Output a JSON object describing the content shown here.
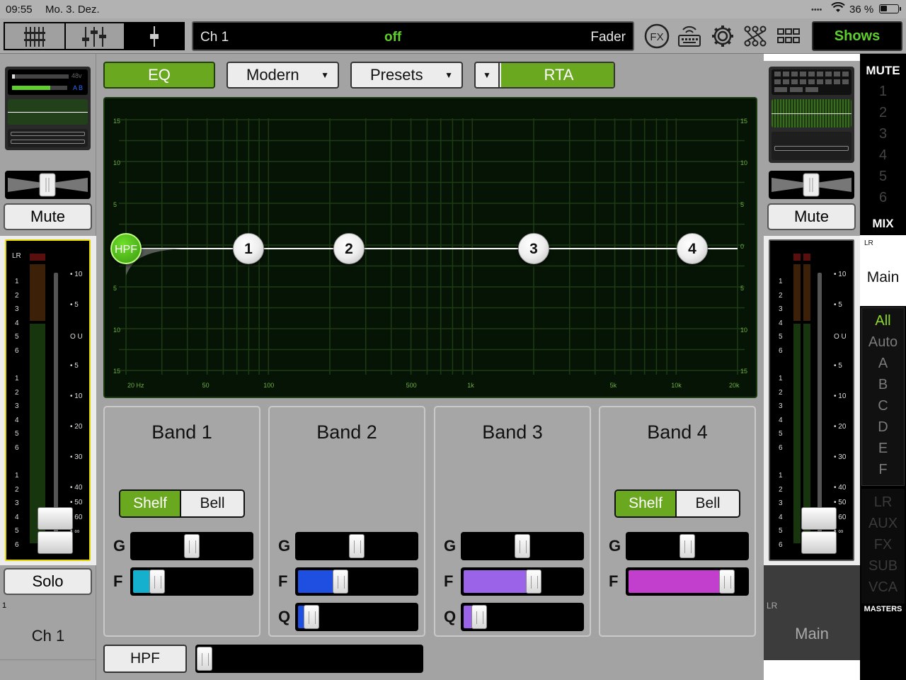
{
  "status": {
    "time": "09:55",
    "date": "Mo. 3. Dez.",
    "battery": "36 %"
  },
  "channel_bar": {
    "name": "Ch 1",
    "state": "off",
    "mode": "Fader"
  },
  "toolbar": {
    "fx_label": "FX",
    "shows_label": "Shows"
  },
  "left": {
    "mute_label": "Mute",
    "solo_label": "Solo",
    "channel_num": "1",
    "channel_name": "Ch 1",
    "phantom": "48v",
    "ab": "A B",
    "meter_lr": "LR"
  },
  "right": {
    "mute_label": "Mute",
    "lr_label": "LR",
    "main_label": "Main",
    "main_bottom": "Main",
    "lr_bottom": "LR"
  },
  "masters": {
    "mute_title": "MUTE",
    "mute_groups": [
      "1",
      "2",
      "3",
      "4",
      "5",
      "6"
    ],
    "mix_title": "MIX",
    "filters": [
      "All",
      "Auto",
      "A",
      "B",
      "C",
      "D",
      "E",
      "F"
    ],
    "types": [
      "LR",
      "AUX",
      "FX",
      "SUB",
      "VCA"
    ],
    "masters_label": "MASTERS"
  },
  "eq_controls": {
    "eq_label": "EQ",
    "mode_label": "Modern",
    "presets_label": "Presets",
    "rta_label": "RTA"
  },
  "graph": {
    "y_labels": [
      "15",
      "10",
      "5",
      "0",
      "5",
      "10",
      "15"
    ],
    "x_labels": [
      "20 Hz",
      "50",
      "100",
      "500",
      "1k",
      "5k",
      "10k",
      "20k"
    ],
    "hpf_label": "HPF",
    "nodes": [
      "1",
      "2",
      "3",
      "4"
    ]
  },
  "meter_scale": [
    "10",
    "5",
    "U",
    "5",
    "10",
    "20",
    "30",
    "40",
    "50",
    "60",
    "∞"
  ],
  "meter_left_nums": [
    "1",
    "2",
    "3",
    "4",
    "5",
    "6",
    "1",
    "2",
    "3",
    "4",
    "5",
    "6",
    "1",
    "2",
    "3",
    "4",
    "5",
    "6"
  ],
  "bands": [
    {
      "title": "Band 1",
      "shelf": "Shelf",
      "bell": "Bell",
      "g": "G",
      "f": "F",
      "q": "",
      "f_color": "#16b0cf",
      "f_value": 0.2
    },
    {
      "title": "Band 2",
      "shelf": "",
      "bell": "",
      "g": "G",
      "f": "F",
      "q": "Q",
      "f_color": "#1f4fe0",
      "f_value": 0.38,
      "q_value": 0.1,
      "q_color": "#1f4fe0"
    },
    {
      "title": "Band 3",
      "shelf": "",
      "bell": "",
      "g": "G",
      "f": "F",
      "q": "Q",
      "f_color": "#9b63e8",
      "f_value": 0.65,
      "q_value": 0.12,
      "q_color": "#9b63e8"
    },
    {
      "title": "Band 4",
      "shelf": "Shelf",
      "bell": "Bell",
      "g": "G",
      "f": "F",
      "q": "",
      "f_color": "#c13fcc",
      "f_value": 0.93
    }
  ],
  "hpf_button": "HPF"
}
